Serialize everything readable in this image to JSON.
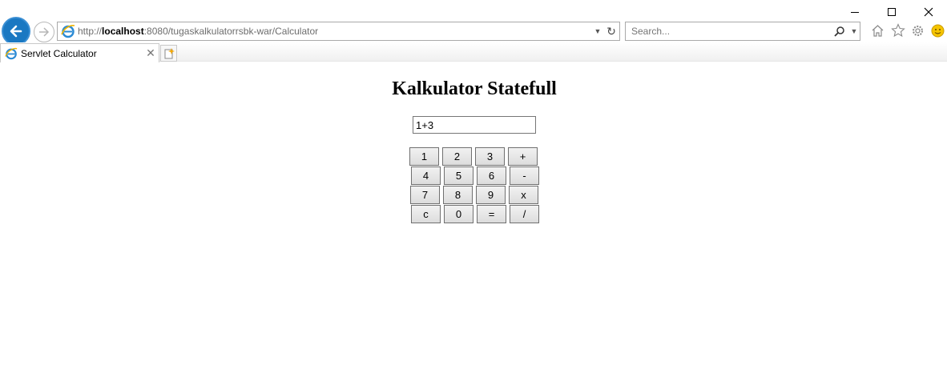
{
  "browser": {
    "address_prefix": "http://",
    "address_host": "localhost",
    "address_rest": ":8080/tugaskalkulatorrsbk-war/Calculator",
    "search_placeholder": "Search...",
    "tab_title": "Servlet Calculator",
    "icons": {
      "back": "back-arrow-icon",
      "forward": "forward-arrow-icon",
      "refresh": "refresh-icon",
      "search": "search-icon",
      "home": "home-icon",
      "favorites": "star-icon",
      "settings": "gear-icon",
      "feedback": "smiley-icon"
    },
    "accent_color": "#1a78c2"
  },
  "page": {
    "title": "Kalkulator Statefull",
    "display_value": "1+3",
    "keypad": [
      [
        "1",
        "2",
        "3",
        "+"
      ],
      [
        "4",
        "5",
        "6",
        "-"
      ],
      [
        "7",
        "8",
        "9",
        "x"
      ],
      [
        "c",
        "0",
        "=",
        "/"
      ]
    ]
  }
}
